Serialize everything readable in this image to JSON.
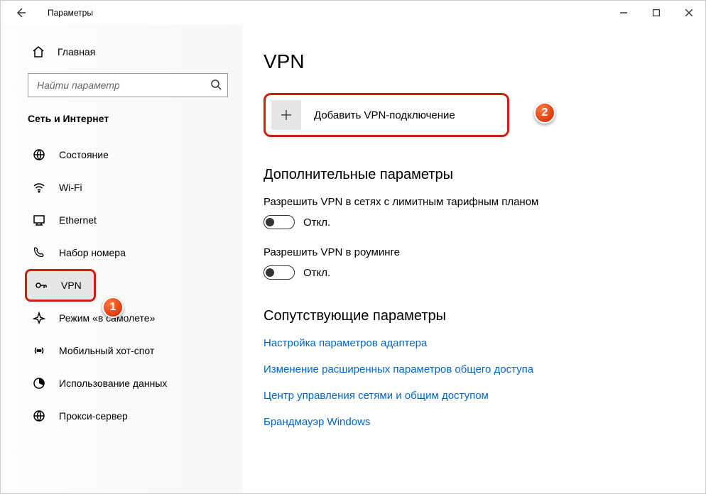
{
  "window": {
    "title": "Параметры"
  },
  "sidebar": {
    "home_label": "Главная",
    "search_placeholder": "Найти параметр",
    "category_header": "Сеть и Интернет",
    "items": [
      {
        "label": "Состояние"
      },
      {
        "label": "Wi-Fi"
      },
      {
        "label": "Ethernet"
      },
      {
        "label": "Набор номера"
      },
      {
        "label": "VPN"
      },
      {
        "label": "Режим «в самолете»"
      },
      {
        "label": "Мобильный хот-спот"
      },
      {
        "label": "Использование данных"
      },
      {
        "label": "Прокси-сервер"
      }
    ]
  },
  "main": {
    "heading": "VPN",
    "add_vpn_label": "Добавить VPN-подключение",
    "advanced_header": "Дополнительные параметры",
    "toggle_metered_label": "Разрешить VPN в сетях с лимитным тарифным планом",
    "toggle_roaming_label": "Разрешить VPN в роуминге",
    "toggle_off_text": "Откл.",
    "related_header": "Сопутствующие параметры",
    "links": [
      "Настройка параметров адаптера",
      "Изменение расширенных параметров общего доступа",
      "Центр управления сетями и общим доступом",
      "Брандмауэр Windows"
    ]
  },
  "annotations": {
    "badge1": "1",
    "badge2": "2"
  }
}
